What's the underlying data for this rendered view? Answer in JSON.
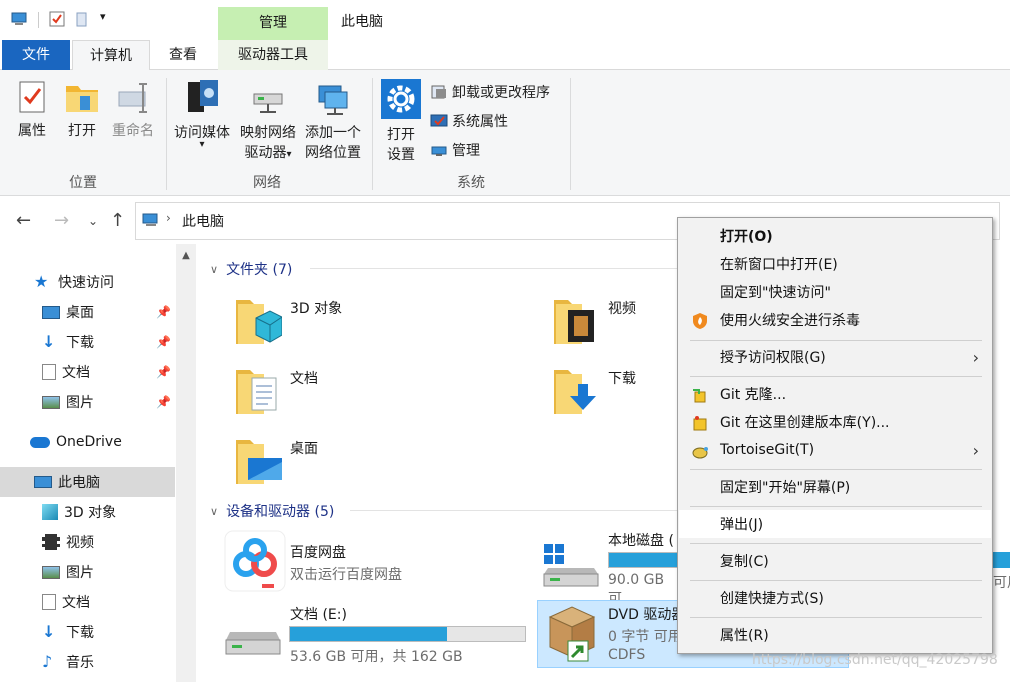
{
  "window": {
    "title": "此电脑",
    "context_tab": "管理"
  },
  "tabs": {
    "file": "文件",
    "computer": "计算机",
    "view": "查看",
    "drive_tools": "驱动器工具"
  },
  "ribbon": {
    "location": {
      "label": "位置",
      "properties": "属性",
      "open": "打开",
      "rename": "重命名"
    },
    "network": {
      "label": "网络",
      "access_media": "访问媒体",
      "map_drive_1": "映射网络",
      "map_drive_2": "驱动器",
      "add_location_1": "添加一个",
      "add_location_2": "网络位置"
    },
    "system": {
      "label": "系统",
      "open_settings_1": "打开",
      "open_settings_2": "设置",
      "uninstall": "卸载或更改程序",
      "system_props": "系统属性",
      "manage": "管理"
    }
  },
  "address": {
    "path": "此电脑"
  },
  "navpane": {
    "quick_access": "快速访问",
    "desktop": "桌面",
    "downloads": "下载",
    "documents": "文档",
    "pictures": "图片",
    "onedrive": "OneDrive",
    "this_pc": "此电脑",
    "objects3d": "3D 对象",
    "videos": "视频",
    "pictures2": "图片",
    "documents2": "文档",
    "downloads2": "下载",
    "music": "音乐"
  },
  "content": {
    "folders_header": "文件夹 (7)",
    "folders": {
      "objects3d": "3D 对象",
      "videos": "视频",
      "documents": "文档",
      "downloads": "下载",
      "desktop": "桌面"
    },
    "devices_header": "设备和驱动器 (5)",
    "baidu": {
      "name": "百度网盘",
      "sub": "双击运行百度网盘"
    },
    "local_disk": {
      "name": "本地磁盘 (",
      "free": "90.0 GB 可",
      "used_fraction": 0.45
    },
    "doc_e": {
      "name": "文档 (E:)",
      "free": "53.6 GB 可用，共 162 GB",
      "used_fraction": 0.67
    },
    "dvd": {
      "name": "DVD 驱动器",
      "sub": "0 字节 可用",
      "fs": "CDFS"
    },
    "right_partial": "可用"
  },
  "context_menu": {
    "open": "打开(O)",
    "open_new_window": "在新窗口中打开(E)",
    "pin_quick": "固定到\"快速访问\"",
    "huorong": "使用火绒安全进行杀毒",
    "grant_access": "授予访问权限(G)",
    "git_clone": "Git 克隆...",
    "git_create": "Git 在这里创建版本库(Y)...",
    "tortoisegit": "TortoiseGit(T)",
    "pin_start": "固定到\"开始\"屏幕(P)",
    "eject": "弹出(J)",
    "copy": "复制(C)",
    "create_shortcut": "创建快捷方式(S)",
    "properties": "属性(R)"
  },
  "watermark": "https://blog.csdn.net/qq_42025798",
  "colors": {
    "accent": "#1a66c0",
    "manage_green": "#c6efb2",
    "bar_fill": "#26a0da",
    "folder": "#f8d775"
  }
}
